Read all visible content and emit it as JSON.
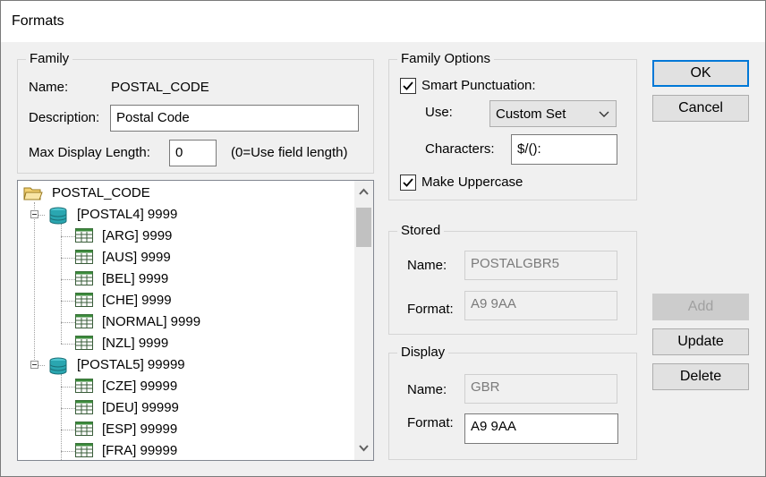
{
  "window": {
    "title": "Formats"
  },
  "family": {
    "group_label": "Family",
    "name_label": "Name:",
    "name_value": "POSTAL_CODE",
    "description_label": "Description:",
    "description_value": "Postal Code",
    "max_length_label": "Max Display Length:",
    "max_length_value": "0",
    "max_length_hint": "(0=Use field length)"
  },
  "tree": {
    "root": "POSTAL_CODE",
    "groups": [
      {
        "label": "[POSTAL4] 9999",
        "children": [
          "[ARG] 9999",
          "[AUS] 9999",
          "[BEL] 9999",
          "[CHE] 9999",
          "[NORMAL] 9999",
          "[NZL] 9999"
        ]
      },
      {
        "label": "[POSTAL5] 99999",
        "children": [
          "[CZE] 99999",
          "[DEU] 99999",
          "[ESP] 99999",
          "[FRA] 99999"
        ]
      }
    ]
  },
  "family_options": {
    "group_label": "Family Options",
    "smart_punctuation_label": "Smart Punctuation:",
    "smart_punctuation_checked": true,
    "use_label": "Use:",
    "use_value": "Custom Set",
    "characters_label": "Characters:",
    "characters_value": "$/():",
    "make_uppercase_label": "Make Uppercase",
    "make_uppercase_checked": true
  },
  "stored": {
    "group_label": "Stored",
    "name_label": "Name:",
    "name_value": "POSTALGBR5",
    "format_label": "Format:",
    "format_value": "A9 9AA"
  },
  "display": {
    "group_label": "Display",
    "name_label": "Name:",
    "name_value": "GBR",
    "format_label": "Format:",
    "format_value": "A9 9AA"
  },
  "buttons": {
    "ok": "OK",
    "cancel": "Cancel",
    "add": "Add",
    "update": "Update",
    "delete": "Delete"
  },
  "colors": {
    "accent": "#0078d7",
    "db_icon": "#2aa6b0",
    "folder": "#f2d072"
  }
}
